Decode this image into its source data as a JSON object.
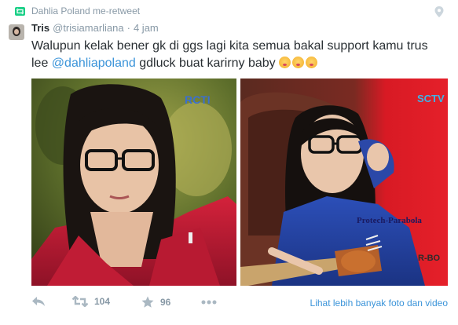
{
  "retweet": {
    "text": "Dahlia Poland me-retweet"
  },
  "tweet": {
    "display_name": "Tris",
    "screen_name": "@trisiamarliana",
    "separator": "·",
    "time": "4 jam",
    "text_part1": "Walupun kelak bener gk di ggs lagi kita semua bakal support kamu trus lee ",
    "mention": "@dahliapoland",
    "text_part2": " gdluck buat karirny baby "
  },
  "media": {
    "left": {
      "watermark": "RCTI"
    },
    "right": {
      "logo": "SCTV",
      "watermark1": "Protech-Parabola",
      "watermark2": "R-BO"
    }
  },
  "actions": {
    "retweet_count": "104",
    "favorite_count": "96",
    "more_link": "Lihat lebih banyak foto dan video"
  },
  "icons": [
    "retweet-small-icon",
    "location-pin-icon",
    "reply-icon",
    "retweet-icon",
    "star-icon",
    "more-icon"
  ],
  "colors": {
    "link": "#3b94d9",
    "muted": "#8899a6",
    "text": "#292f33",
    "retweet_green": "#19cf86"
  }
}
